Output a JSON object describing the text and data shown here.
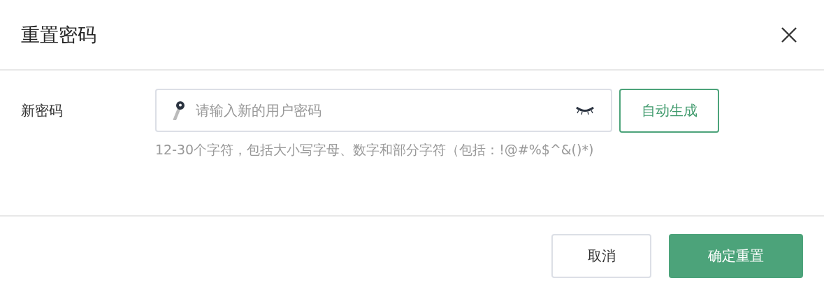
{
  "dialog": {
    "title": "重置密码"
  },
  "form": {
    "label": "新密码",
    "password_field": {
      "placeholder": "请输入新的用户密码"
    },
    "generate_button": "自动生成",
    "hint": "12-30个字符，包括大小写字母、数字和部分字符（包括：!@#%$^&()*)"
  },
  "buttons": [
    {
      "label": "取消",
      "kind": "secondary"
    },
    {
      "label": "确定重置",
      "kind": "primary"
    }
  ]
}
